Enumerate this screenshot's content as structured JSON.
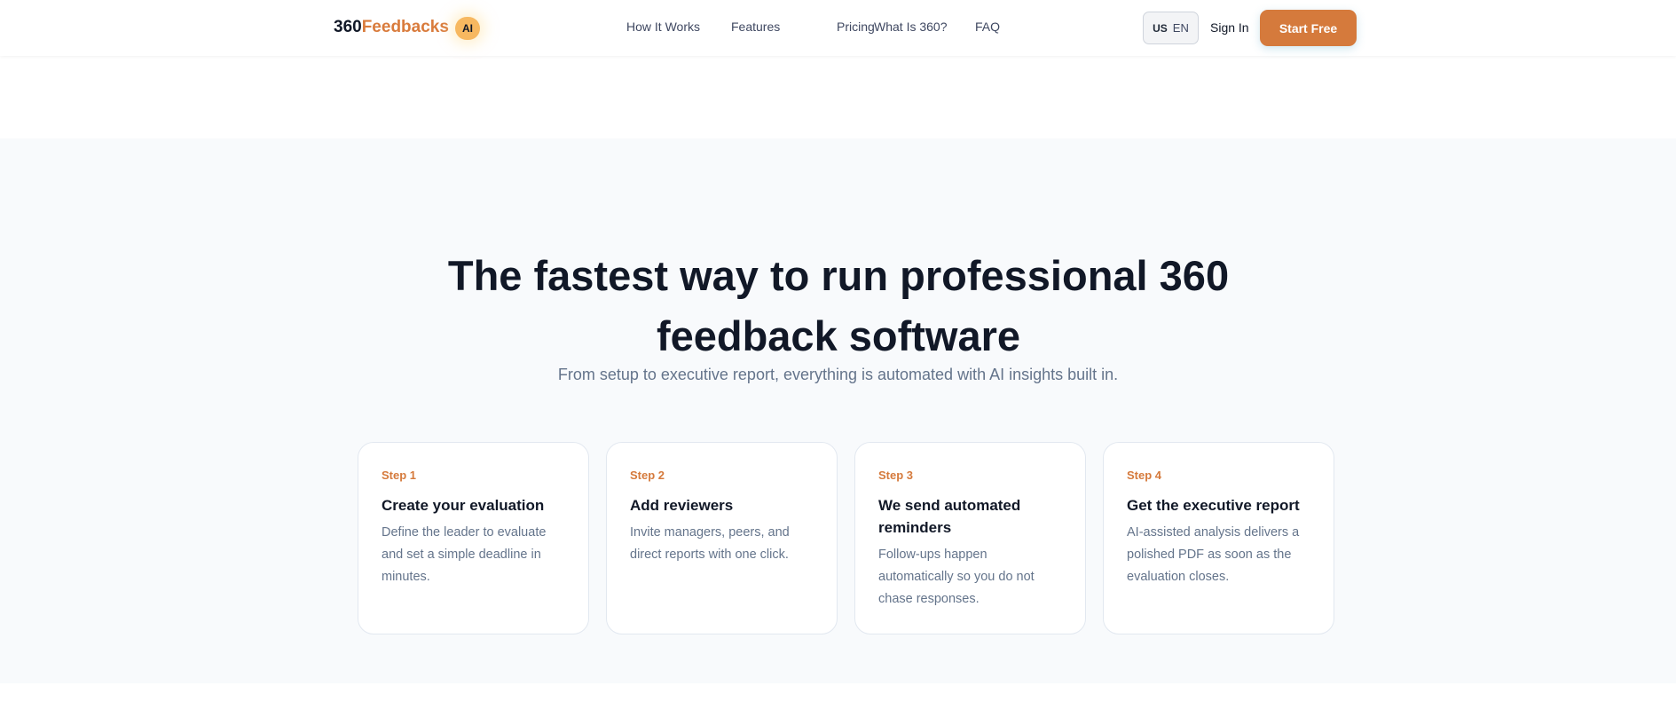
{
  "header": {
    "logo_part1": "360",
    "logo_part2": "Feedbacks",
    "ai_badge": "AI",
    "nav": [
      "How It Works",
      "Features",
      "Pricing",
      "What Is 360?",
      "FAQ"
    ],
    "lang_flag": "US",
    "lang_code": "EN",
    "sign_in": "Sign In",
    "start_free": "Start Free"
  },
  "hero": {
    "title": "The fastest way to run professional 360 feedback software",
    "subtitle": "From setup to executive report, everything is automated with AI insights built in."
  },
  "steps": [
    {
      "label": "Step 1",
      "title": "Create your evaluation",
      "desc": "Define the leader to evaluate and set a simple deadline in minutes."
    },
    {
      "label": "Step 2",
      "title": "Add reviewers",
      "desc": "Invite managers, peers, and direct reports with one click."
    },
    {
      "label": "Step 3",
      "title": "We send automated reminders",
      "desc": "Follow-ups happen automatically so you do not chase responses."
    },
    {
      "label": "Step 4",
      "title": "Get the executive report",
      "desc": "AI-assisted analysis delivers a polished PDF as soon as the evaluation closes."
    }
  ],
  "colors": {
    "accent": "#d57a3c",
    "text": "#111827",
    "muted": "#64748b"
  }
}
